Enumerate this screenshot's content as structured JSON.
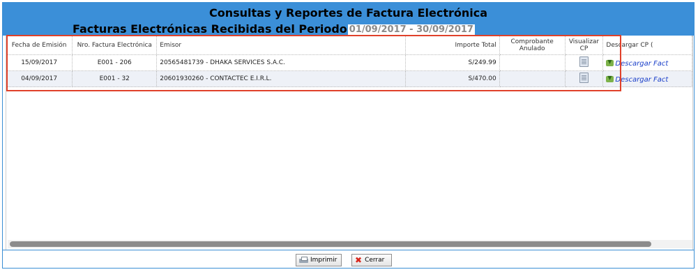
{
  "header": {
    "title": "Consultas y Reportes de Factura Electrónica",
    "subtitle": "Facturas Electrónicas Recibidas del Periodo",
    "period": "01/09/2017 - 30/09/2017"
  },
  "table": {
    "columns": {
      "fecha": "Fecha de Emisión",
      "nro": "Nro. Factura Electrónica",
      "emisor": "Emisor",
      "importe": "Importe Total",
      "anulado": "Comprobante Anulado",
      "visualizar": "Visualizar CP",
      "descargar": "Descargar CP ("
    },
    "rows": [
      {
        "fecha": "15/09/2017",
        "nro": "E001 - 206",
        "emisor": "20565481739 - DHAKA SERVICES S.A.C.",
        "importe": "S/249.99",
        "anulado": "",
        "visualizar_icon": "document-icon",
        "descargar": "Descargar Fact"
      },
      {
        "fecha": "04/09/2017",
        "nro": "E001 - 32",
        "emisor": "20601930260 - CONTACTEC E.I.R.L.",
        "importe": "S/470.00",
        "anulado": "",
        "visualizar_icon": "document-icon",
        "descargar": "Descargar Fact"
      }
    ]
  },
  "footer": {
    "print_label": "Imprimir",
    "close_label": "Cerrar"
  },
  "colors": {
    "header_bg": "#3b8fd8",
    "highlight_border": "#e0412a",
    "link": "#1a3fc9",
    "alt_row": "#eef1f7"
  }
}
